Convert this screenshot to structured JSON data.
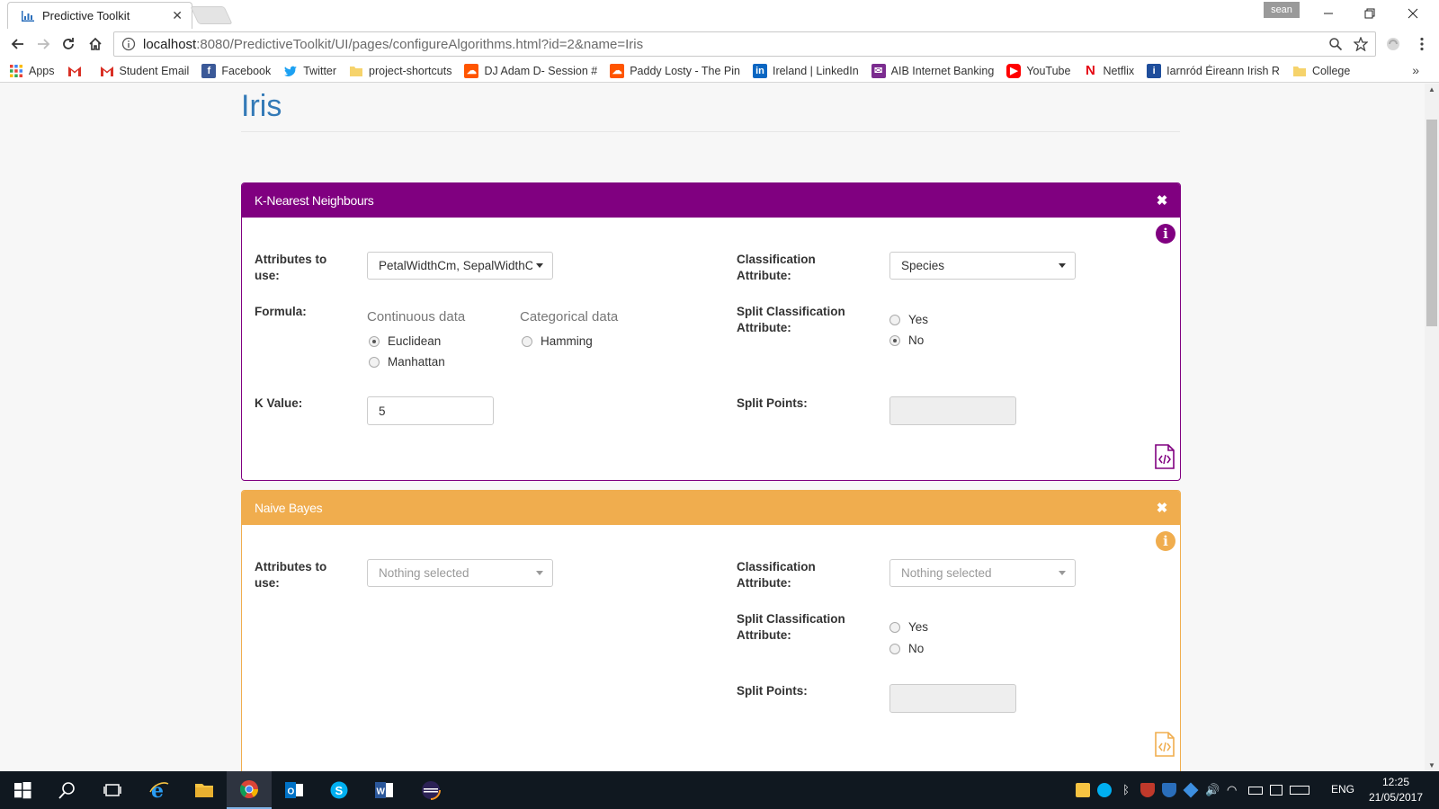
{
  "browser": {
    "tab_title": "Predictive Toolkit",
    "user_badge": "sean",
    "url_host": "localhost",
    "url_path": ":8080/PredictiveToolkit/UI/pages/configureAlgorithms.html?id=2&name=Iris",
    "bookmarks": [
      {
        "label": "Apps",
        "icon": "apps-grid-icon",
        "color": "#e94235"
      },
      {
        "label": "",
        "icon": "gmail-icon",
        "color": "#d93025"
      },
      {
        "label": "Student Email",
        "icon": "gmail-icon",
        "color": "#d93025"
      },
      {
        "label": "Facebook",
        "icon": "facebook-icon",
        "color": "#3b5998"
      },
      {
        "label": "Twitter",
        "icon": "twitter-icon",
        "color": "#1da1f2"
      },
      {
        "label": "project-shortcuts",
        "icon": "folder-icon",
        "color": "#f6d36b"
      },
      {
        "label": "DJ Adam D- Session #",
        "icon": "soundcloud-icon",
        "color": "#ff5500"
      },
      {
        "label": "Paddy Losty - The Pin",
        "icon": "soundcloud-icon",
        "color": "#ff5500"
      },
      {
        "label": "Ireland | LinkedIn",
        "icon": "linkedin-icon",
        "color": "#0a66c2"
      },
      {
        "label": "AIB Internet Banking",
        "icon": "aib-icon",
        "color": "#7b2c8f"
      },
      {
        "label": "YouTube",
        "icon": "youtube-icon",
        "color": "#ff0000"
      },
      {
        "label": "Netflix",
        "icon": "netflix-icon",
        "color": "#e50914"
      },
      {
        "label": "Iarnród Éireann Irish R",
        "icon": "irish-rail-icon",
        "color": "#1f4e9c"
      },
      {
        "label": "College",
        "icon": "folder-icon",
        "color": "#f6d36b"
      }
    ]
  },
  "page": {
    "title": "Iris"
  },
  "knn": {
    "title": "K-Nearest Neighbours",
    "color": "#800080",
    "attributes_label": "Attributes to use:",
    "attributes_value": "PetalWidthCm, SepalWidthCm",
    "classification_label": "Classification Attribute:",
    "classification_value": "Species",
    "formula_label": "Formula:",
    "continuous_label": "Continuous data",
    "categorical_label": "Categorical data",
    "euclidean": "Euclidean",
    "manhattan": "Manhattan",
    "hamming": "Hamming",
    "split_class_label": "Split Classification Attribute:",
    "yes": "Yes",
    "no": "No",
    "k_label": "K Value:",
    "k_value": "5",
    "split_points_label": "Split Points:"
  },
  "nb": {
    "title": "Naive Bayes",
    "color": "#f0ad4e",
    "attributes_label": "Attributes to use:",
    "attributes_value": "Nothing selected",
    "classification_label": "Classification Attribute:",
    "classification_value": "Nothing selected",
    "split_class_label": "Split Classification Attribute:",
    "yes": "Yes",
    "no": "No",
    "split_points_label": "Split Points:"
  },
  "taskbar": {
    "lang": "ENG",
    "time": "12:25",
    "date": "21/05/2017"
  }
}
